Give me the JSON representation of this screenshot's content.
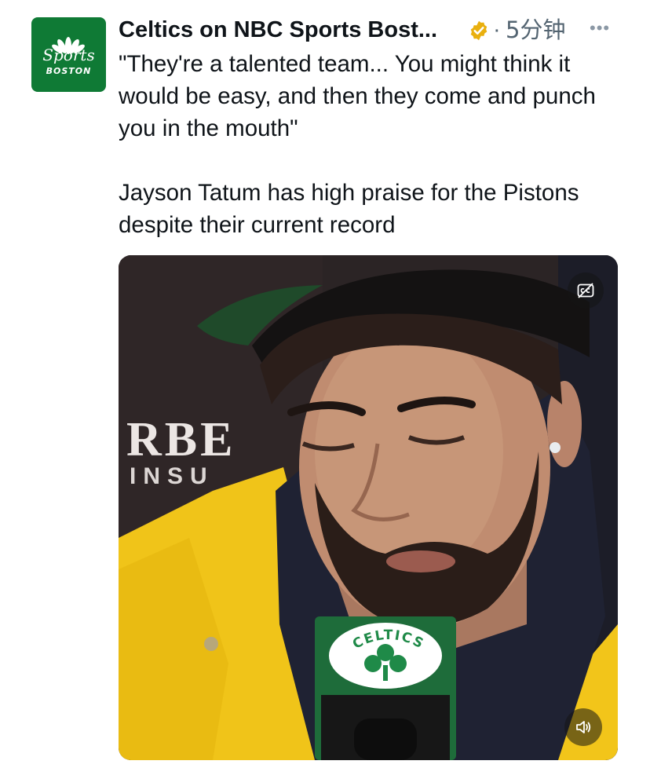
{
  "tweet": {
    "author_name": "Celtics on NBC Sports Bost...",
    "separator": "·",
    "time": "5分钟",
    "more_label": "•••",
    "quote": "\"They're a talented team... You might think it would be easy, and then they come and punch you in the mouth\"",
    "body": "Jayson Tatum has high praise for the Pistons despite their current record"
  },
  "avatar": {
    "line1": "Sports",
    "line2": "BOSTON",
    "color": "#0f7a35"
  },
  "media": {
    "backdrop_text_1": "RBE",
    "backdrop_text_2": "INSU",
    "mic_flag_text": "CELTICS",
    "captions_icon": "captions-off-icon",
    "sound_icon": "speaker-icon"
  },
  "colors": {
    "verified_badge": "#e9b00f",
    "secondary_text": "#536471",
    "jacket": "#f0c419",
    "celtics_green": "#1f8a48"
  }
}
